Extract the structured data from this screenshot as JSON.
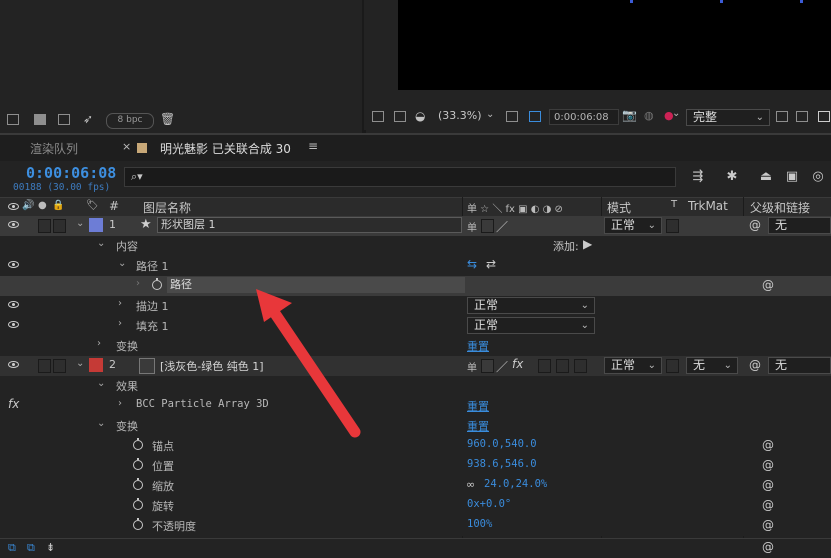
{
  "project_bar": {
    "bpc": "8 bpc"
  },
  "viewer_bar": {
    "zoom": "(33.3%)",
    "timecode": "0:00:06:08",
    "quality": "完整"
  },
  "tabs": {
    "render_queue": "渲染队列",
    "comp_close": "×",
    "comp_name": "明光魅影 已关联合成 30",
    "menu": "≡"
  },
  "timeline": {
    "timecode": "0:00:06:08",
    "frames": "00188 (30.00 fps)",
    "search_icon": "search-icon",
    "header": {
      "hash": "#",
      "layer_name": "图层名称",
      "mode": "模式",
      "t": "T",
      "trkmat": "TrkMat",
      "parent": "父级和链接",
      "switches": "单 ☆ ＼ fx ▣ ◐ ◑ ⊘"
    },
    "layers": [
      {
        "num": "1",
        "name": "形状图层 1",
        "mode": "正常",
        "parent": "无",
        "color": "#6d7dd6"
      },
      {
        "num": "2",
        "name": "[浅灰色-绿色 纯色 1]",
        "mode": "正常",
        "trkmat": "无",
        "parent": "无",
        "color": "#c53a36"
      }
    ],
    "rows": {
      "contents": "内容",
      "add": "添加:",
      "path1": "路径 1",
      "path": "路径",
      "stroke1": "描边 1",
      "stroke_mode": "正常",
      "fill1": "填充 1",
      "fill_mode": "正常",
      "transform1": "变换",
      "reset": "重置",
      "effects": "效果",
      "fx": "fx",
      "bcc": "BCC Particle Array 3D",
      "reset2": "重置",
      "transform2": "变换",
      "reset3": "重置",
      "anchor": "锚点",
      "anchor_val": "960.0,540.0",
      "position": "位置",
      "position_val": "938.6,546.0",
      "scale": "缩放",
      "scale_val": "24.0,24.0%",
      "rotation": "旋转",
      "rotation_val": "0x+0.0°",
      "opacity": "不透明度",
      "opacity_val": "100%"
    }
  },
  "colors": {
    "accent": "#3a8cdc",
    "arrow": "#e8373a"
  }
}
